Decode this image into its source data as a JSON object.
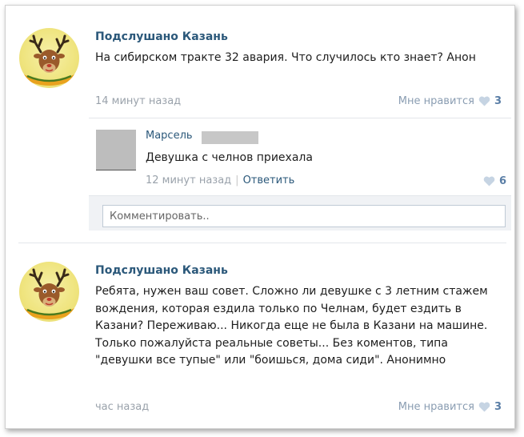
{
  "posts": [
    {
      "author": "Подслушано Казань",
      "text": "На сибирском тракте 32 авария. Что случилось кто знает? Анон",
      "time": "14 минут назад",
      "like_label": "Мне нравится",
      "like_count": "3",
      "comment": {
        "author": "Марсель",
        "text": "Девушка с челнов приехала",
        "time": "12 минут назад",
        "separator": "|",
        "reply_label": "Ответить",
        "like_count": "6"
      },
      "comment_placeholder": "Комментировать.."
    },
    {
      "author": "Подслушано Казань",
      "text": "Ребята, нужен ваш совет. Сложно ли девушке с 3 летним стажем вождения, которая ездила только по Челнам, будет ездить в Казани? Переживаю... Никогда еще не была в Казани на машине. Только пожалуйста реальные советы... Без коментов, типа \"девушки все тупые\" или \"боишься, дома сиди\". Анонимно",
      "time": "час назад",
      "like_label": "Мне нравится",
      "like_count": "3"
    }
  ],
  "avatar_logo_text": "Подслушано Казань",
  "colors": {
    "link": "#2b587a",
    "muted": "#9aa2ab",
    "like": "#5a7ea6",
    "heart": "#c6d4e3",
    "avatar_bg": "#efe47e"
  }
}
